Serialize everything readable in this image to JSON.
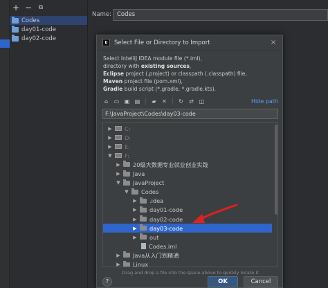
{
  "project_structure": {
    "toolbar": {
      "add": "+",
      "remove": "−",
      "copy": "⧉"
    },
    "modules": [
      {
        "label": "Codes",
        "selected": true
      },
      {
        "label": "day01-code",
        "selected": false
      },
      {
        "label": "day02-code",
        "selected": false
      }
    ],
    "name_label": "Name:",
    "name_value": "Codes"
  },
  "dialog": {
    "logo": "IJ",
    "title": "Select File or Directory to Import",
    "close": "×",
    "description": {
      "line1": "Select IntelliJ IDEA module file (*.iml),",
      "line2_pre": "directory with ",
      "line2_bold": "existing sources",
      "line2_post": ",",
      "line3_bold": "Eclipse",
      "line3_post": " project (.project) or classpath (.classpath) file,",
      "line4_bold": "Maven",
      "line4_post": " project file (pom.xml),",
      "line5_bold": "Gradle",
      "line5_post": " build script (*.gradle, *.gradle.kts)."
    },
    "toolbar": {
      "home": "⌂",
      "desktop": "▭",
      "project": "▣",
      "module": "▤",
      "new_folder": "▰",
      "delete": "✕",
      "refresh": "↻",
      "link": "⇄",
      "show_hidden": "◫",
      "hide_path": "Hide path"
    },
    "path": "F:\\JavaProject\\Codes\\day03-code",
    "tree": [
      {
        "label": "C:",
        "expanded": false,
        "kind": "drive",
        "dim": true
      },
      {
        "label": "D:",
        "expanded": false,
        "kind": "drive",
        "dim": true
      },
      {
        "label": "E:",
        "expanded": false,
        "kind": "drive",
        "dim": true
      },
      {
        "label": "F:",
        "expanded": true,
        "kind": "drive",
        "dim": true
      },
      {
        "label": "20级大数据专业就业创业实践",
        "expanded": false,
        "kind": "folder"
      },
      {
        "label": "Java",
        "expanded": false,
        "kind": "folder"
      },
      {
        "label": "JavaProject",
        "expanded": true,
        "kind": "folder"
      },
      {
        "label": "Codes",
        "expanded": true,
        "kind": "folder"
      },
      {
        "label": ".idea",
        "expanded": false,
        "kind": "folder"
      },
      {
        "label": "day01-code",
        "expanded": false,
        "kind": "folder"
      },
      {
        "label": "day02-code",
        "expanded": false,
        "kind": "folder"
      },
      {
        "label": "day03-code",
        "expanded": false,
        "kind": "folder",
        "selected": true
      },
      {
        "label": "out",
        "expanded": false,
        "kind": "folder"
      },
      {
        "label": "Codes.iml",
        "kind": "file"
      },
      {
        "label": "Java从入门到精通",
        "expanded": false,
        "kind": "folder"
      },
      {
        "label": "Linux",
        "expanded": false,
        "kind": "folder"
      }
    ],
    "drag_hint": "Drag and drop a file into the space above to quickly locate it",
    "help": "?",
    "ok": "OK",
    "cancel": "Cancel"
  },
  "colors": {
    "selection": "#2f65ca",
    "annotation_arrow": "#e02020",
    "link": "#589df6"
  }
}
